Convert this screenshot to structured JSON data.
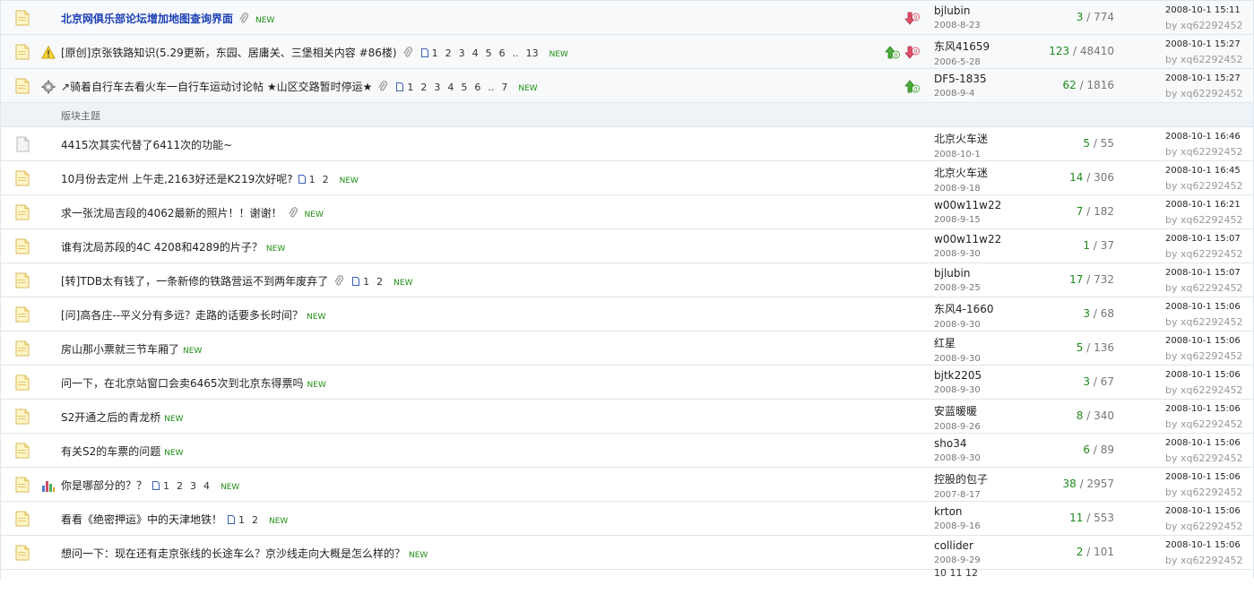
{
  "colors": {
    "title_bold": "#1c3fb4",
    "new_badge": "#1d8f12",
    "reply_count": "#1e8b1e",
    "muted": "#999999",
    "section_bg": "#eef3f8",
    "border": "#dfe6ec"
  },
  "section_label": "版块主题",
  "by_prefix": "by",
  "new_label": "NEW",
  "pager_tail_text": "10 11 12",
  "sticky_threads": [
    {
      "title": "北京网俱乐部论坛增加地图查询界面",
      "bold": true,
      "type_icon": "",
      "attachment": true,
      "pages": [],
      "rating": [
        "heart-down-icon"
      ],
      "author": "bjlubin",
      "date": "2008-8-23",
      "replies": "3",
      "views": "774",
      "last_time": "2008-10-1 15:11",
      "last_user": "xq62292452"
    },
    {
      "title": "[原创]京张铁路知识(5.29更新，东园、居庸关、三堡相关内容 #86楼)",
      "bold": false,
      "type_icon": "warning-icon",
      "attachment": true,
      "pages": [
        "1",
        "2",
        "3",
        "4",
        "5",
        "6",
        "..",
        "13"
      ],
      "rating": [
        "arrow-up-icon",
        "heart-down-icon"
      ],
      "author": "东风41659",
      "date": "2006-5-28",
      "replies": "123",
      "views": "48410",
      "last_time": "2008-10-1 15:27",
      "last_user": "xq62292452"
    },
    {
      "title": "↗骑着自行车去看火车一自行车运动讨论帖 ★山区交路暂时停运★",
      "bold": false,
      "type_icon": "gear-icon",
      "attachment": true,
      "pages": [
        "1",
        "2",
        "3",
        "4",
        "5",
        "6",
        "..",
        "7"
      ],
      "rating": [
        "arrow-up-icon"
      ],
      "author": "DF5-1835",
      "date": "2008-9-4",
      "replies": "62",
      "views": "1816",
      "last_time": "2008-10-1 15:27",
      "last_user": "xq62292452"
    }
  ],
  "threads": [
    {
      "title": "4415次其实代替了6411次的功能~",
      "status": "plain",
      "type_icon": "",
      "attachment": false,
      "pages": [],
      "new": false,
      "author": "北京火车迷",
      "date": "2008-10-1",
      "replies": "5",
      "views": "55",
      "last_time": "2008-10-1 16:46",
      "last_user": "xq62292452"
    },
    {
      "title": "10月份去定州  上午走,2163好还是K219次好呢?",
      "status": "new",
      "type_icon": "",
      "attachment": false,
      "pages": [
        "1",
        "2"
      ],
      "new": true,
      "author": "北京火车迷",
      "date": "2008-9-18",
      "replies": "14",
      "views": "306",
      "last_time": "2008-10-1 16:45",
      "last_user": "xq62292452"
    },
    {
      "title": "求一张沈局吉段的4062最新的照片！！谢谢！",
      "status": "new",
      "type_icon": "",
      "attachment": true,
      "pages": [],
      "new": true,
      "author": "w00w11w22",
      "date": "2008-9-15",
      "replies": "7",
      "views": "182",
      "last_time": "2008-10-1 16:21",
      "last_user": "xq62292452"
    },
    {
      "title": "谁有沈局苏段的4C 4208和4289的片子？",
      "status": "new",
      "type_icon": "",
      "attachment": false,
      "pages": [],
      "new": true,
      "author": "w00w11w22",
      "date": "2008-9-30",
      "replies": "1",
      "views": "37",
      "last_time": "2008-10-1 15:07",
      "last_user": "xq62292452"
    },
    {
      "title": "[转]TDB太有钱了，一条新修的铁路营运不到两年废弃了",
      "status": "new",
      "type_icon": "",
      "attachment": true,
      "pages": [
        "1",
        "2"
      ],
      "new": true,
      "author": "bjlubin",
      "date": "2008-9-25",
      "replies": "17",
      "views": "732",
      "last_time": "2008-10-1 15:07",
      "last_user": "xq62292452"
    },
    {
      "title": "[问]高各庄--平义分有多远？走路的话要多长时间？",
      "status": "new",
      "type_icon": "",
      "attachment": false,
      "pages": [],
      "new": true,
      "author": "东风4-1660",
      "date": "2008-9-30",
      "replies": "3",
      "views": "68",
      "last_time": "2008-10-1 15:06",
      "last_user": "xq62292452"
    },
    {
      "title": "房山那小票就三节车厢了",
      "status": "new",
      "type_icon": "",
      "attachment": false,
      "pages": [],
      "new": true,
      "author": "红星",
      "date": "2008-9-30",
      "replies": "5",
      "views": "136",
      "last_time": "2008-10-1 15:06",
      "last_user": "xq62292452"
    },
    {
      "title": "问一下，在北京站窗口会卖6465次到北京东得票吗",
      "status": "new",
      "type_icon": "",
      "attachment": false,
      "pages": [],
      "new": true,
      "author": "bjtk2205",
      "date": "2008-9-30",
      "replies": "3",
      "views": "67",
      "last_time": "2008-10-1 15:06",
      "last_user": "xq62292452"
    },
    {
      "title": "S2开通之后的青龙桥",
      "status": "new",
      "type_icon": "",
      "attachment": false,
      "pages": [],
      "new": true,
      "author": "安蓝暖暖",
      "date": "2008-9-26",
      "replies": "8",
      "views": "340",
      "last_time": "2008-10-1 15:06",
      "last_user": "xq62292452"
    },
    {
      "title": "有关S2的车票的问题",
      "status": "new",
      "type_icon": "",
      "attachment": false,
      "pages": [],
      "new": true,
      "author": "sho34",
      "date": "2008-9-30",
      "replies": "6",
      "views": "89",
      "last_time": "2008-10-1 15:06",
      "last_user": "xq62292452"
    },
    {
      "title": "你是哪部分的？？",
      "status": "new",
      "type_icon": "poll-chart-icon",
      "attachment": false,
      "pages": [
        "1",
        "2",
        "3",
        "4"
      ],
      "new": true,
      "author": "控股的包子",
      "date": "2007-8-17",
      "replies": "38",
      "views": "2957",
      "last_time": "2008-10-1 15:06",
      "last_user": "xq62292452"
    },
    {
      "title": "看看《绝密押运》中的天津地铁！",
      "status": "new",
      "type_icon": "",
      "attachment": false,
      "pages": [
        "1",
        "2"
      ],
      "new": true,
      "author": "krton",
      "date": "2008-9-16",
      "replies": "11",
      "views": "553",
      "last_time": "2008-10-1 15:06",
      "last_user": "xq62292452"
    },
    {
      "title": "想问一下：现在还有走京张线的长途车么？京沙线走向大概是怎么样的？",
      "status": "new",
      "type_icon": "",
      "attachment": false,
      "pages": [],
      "new": true,
      "author": "collider",
      "date": "2008-9-29",
      "replies": "2",
      "views": "101",
      "last_time": "2008-10-1 15:06",
      "last_user": "xq62292452"
    }
  ]
}
